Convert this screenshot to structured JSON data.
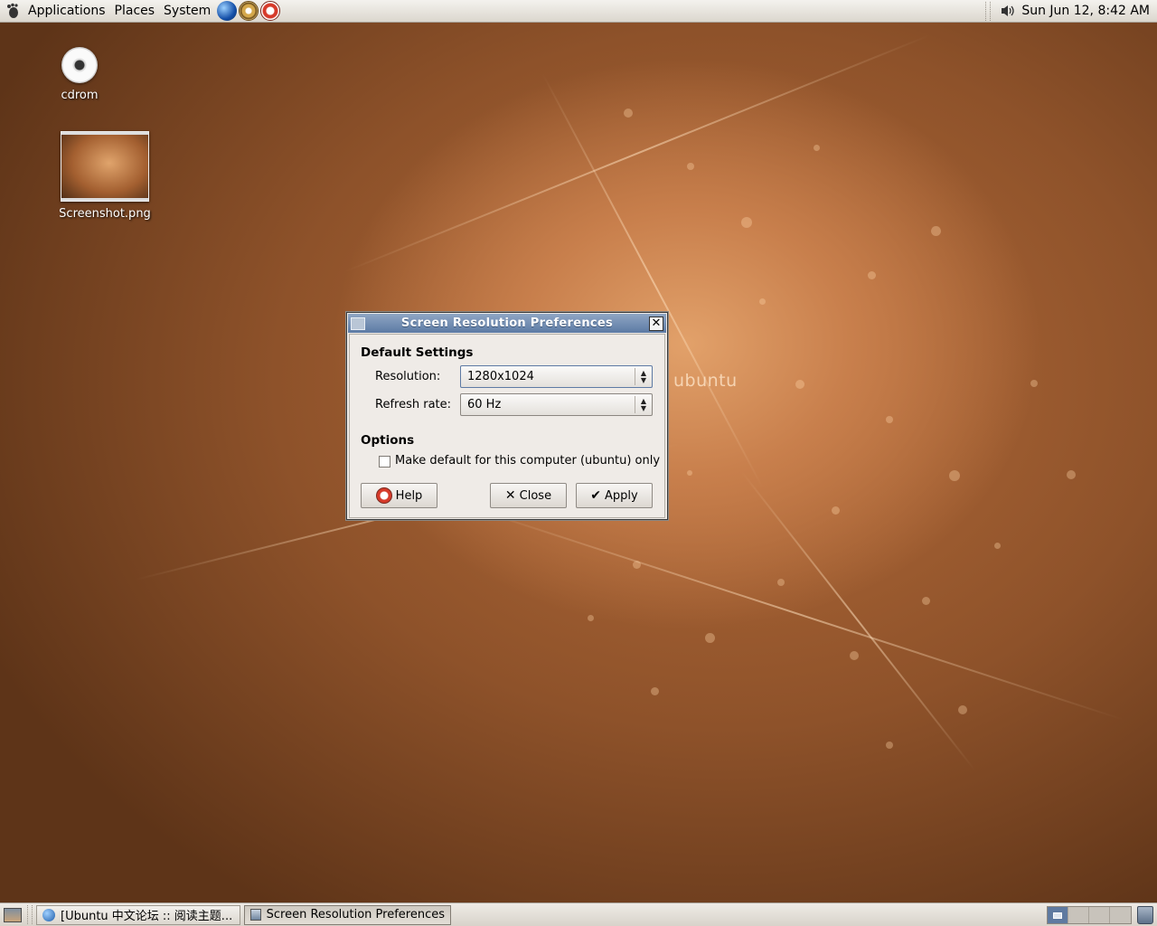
{
  "top_panel": {
    "menus": [
      "Applications",
      "Places",
      "System"
    ],
    "clock": "Sun Jun 12,  8:42 AM",
    "launchers": [
      "firefox-globe-icon",
      "evolution-icon",
      "help-icon"
    ]
  },
  "desktop": {
    "icons": [
      {
        "label": "cdrom",
        "icon": "cdrom-icon"
      },
      {
        "label": "Screenshot.png",
        "icon": "image-thumbnail"
      }
    ],
    "watermark": "ubuntu"
  },
  "dialog": {
    "title": "Screen Resolution Preferences",
    "default_settings_heading": "Default Settings",
    "resolution_label": "Resolution:",
    "resolution_value": "1280x1024",
    "refresh_label": "Refresh rate:",
    "refresh_value": "60 Hz",
    "options_heading": "Options",
    "checkbox_label": "Make default for this computer (ubuntu) only",
    "checkbox_checked": false,
    "help_label": "Help",
    "close_label": "Close",
    "apply_label": "Apply"
  },
  "bottom_panel": {
    "tasks": [
      {
        "label": "[Ubuntu 中文论坛 :: 阅读主题...",
        "active": false
      },
      {
        "label": "Screen Resolution Preferences",
        "active": true
      }
    ],
    "workspaces": 4,
    "current_workspace": 1
  },
  "colors": {
    "titlebar": "#5c7aa4",
    "panel": "#dcd7ce",
    "wallpaper": "#b56c3a"
  }
}
